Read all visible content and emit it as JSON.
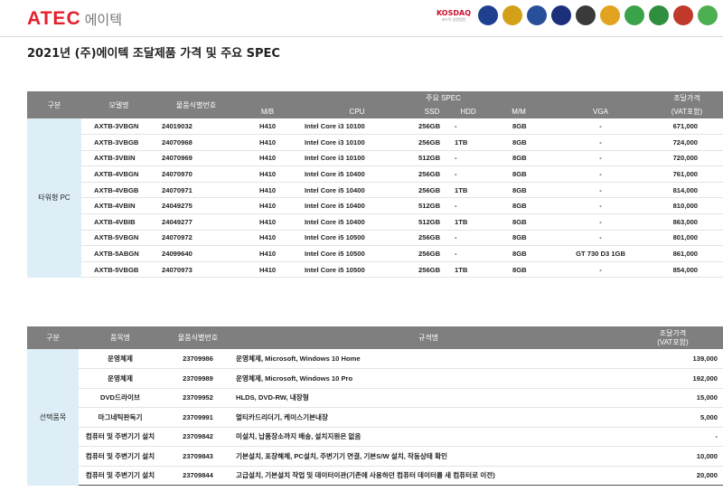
{
  "header": {
    "logo_en": "ATEC",
    "logo_ko": "에이텍",
    "cert_logos": [
      {
        "name": "kosdaq",
        "label": "KOSDAQ",
        "sub": "코스닥 상장법인",
        "color": "#c8102e"
      },
      {
        "name": "cert-circle-1",
        "label": "",
        "color": "#1f3f8f"
      },
      {
        "name": "cert-circle-2",
        "label": "",
        "color": "#d4a017"
      },
      {
        "name": "cert-circle-3",
        "label": "",
        "color": "#2a4f9a"
      },
      {
        "name": "cert-circle-4",
        "label": "",
        "color": "#1c2f7a"
      },
      {
        "name": "cert-circle-5",
        "label": "",
        "color": "#3a3a3a"
      },
      {
        "name": "cert-circle-6",
        "label": "",
        "color": "#e2a320"
      },
      {
        "name": "cert-circle-7",
        "label": "",
        "color": "#3aa34a"
      },
      {
        "name": "cert-circle-8",
        "label": "",
        "color": "#2f8f3f"
      },
      {
        "name": "cert-circle-9",
        "label": "",
        "color": "#c0392b"
      },
      {
        "name": "cert-circle-10",
        "label": "",
        "color": "#4caf50"
      }
    ]
  },
  "title": "2021년 (주)에이텍 조달제품 가격 및 주요 SPEC",
  "table1": {
    "headers": {
      "category": "구분",
      "model": "모델명",
      "item_no": "물품식별번호",
      "spec": "주요 SPEC",
      "price": "조달가격",
      "mb": "M/B",
      "cpu": "CPU",
      "ssd": "SSD",
      "hdd": "HDD",
      "mm": "M/M",
      "vga": "VGA",
      "vat": "(VAT포함)"
    },
    "category": "타워형 PC",
    "rows": [
      {
        "model": "AXTB-3VBGN",
        "item_no": "24019032",
        "mb": "H410",
        "cpu": "Intel Core i3 10100",
        "ssd": "256GB",
        "hdd": "-",
        "mm": "8GB",
        "vga": "-",
        "price": "671,000"
      },
      {
        "model": "AXTB-3VBGB",
        "item_no": "24070968",
        "mb": "H410",
        "cpu": "Intel Core i3 10100",
        "ssd": "256GB",
        "hdd": "1TB",
        "mm": "8GB",
        "vga": "-",
        "price": "724,000"
      },
      {
        "model": "AXTB-3VBIN",
        "item_no": "24070969",
        "mb": "H410",
        "cpu": "Intel Core i3 10100",
        "ssd": "512GB",
        "hdd": "-",
        "mm": "8GB",
        "vga": "-",
        "price": "720,000"
      },
      {
        "model": "AXTB-4VBGN",
        "item_no": "24070970",
        "mb": "H410",
        "cpu": "Intel Core i5 10400",
        "ssd": "256GB",
        "hdd": "-",
        "mm": "8GB",
        "vga": "-",
        "price": "761,000"
      },
      {
        "model": "AXTB-4VBGB",
        "item_no": "24070971",
        "mb": "H410",
        "cpu": "Intel Core i5 10400",
        "ssd": "256GB",
        "hdd": "1TB",
        "mm": "8GB",
        "vga": "-",
        "price": "814,000"
      },
      {
        "model": "AXTB-4VBIN",
        "item_no": "24049275",
        "mb": "H410",
        "cpu": "Intel Core i5 10400",
        "ssd": "512GB",
        "hdd": "-",
        "mm": "8GB",
        "vga": "-",
        "price": "810,000"
      },
      {
        "model": "AXTB-4VBIB",
        "item_no": "24049277",
        "mb": "H410",
        "cpu": "Intel Core i5 10400",
        "ssd": "512GB",
        "hdd": "1TB",
        "mm": "8GB",
        "vga": "-",
        "price": "863,000"
      },
      {
        "model": "AXTB-5VBGN",
        "item_no": "24070972",
        "mb": "H410",
        "cpu": "Intel Core i5 10500",
        "ssd": "256GB",
        "hdd": "-",
        "mm": "8GB",
        "vga": "-",
        "price": "801,000"
      },
      {
        "model": "AXTB-5ABGN",
        "item_no": "24099640",
        "mb": "H410",
        "cpu": "Intel Core i5 10500",
        "ssd": "256GB",
        "hdd": "-",
        "mm": "8GB",
        "vga": "GT 730 D3 1GB",
        "price": "861,000"
      },
      {
        "model": "AXTB-5VBGB",
        "item_no": "24070973",
        "mb": "H410",
        "cpu": "Intel Core i5 10500",
        "ssd": "256GB",
        "hdd": "1TB",
        "mm": "8GB",
        "vga": "-",
        "price": "854,000"
      }
    ]
  },
  "table2": {
    "headers": {
      "category": "구분",
      "name": "품목명",
      "item_no": "물품식별번호",
      "spec": "규격명",
      "price_line1": "조달가격",
      "price_line2": "(VAT포함)"
    },
    "category": "선택품목",
    "rows": [
      {
        "name": "운영체제",
        "item_no": "23709986",
        "spec": "운영체제, Microsoft, Windows 10 Home",
        "price": "139,000"
      },
      {
        "name": "운영체제",
        "item_no": "23709989",
        "spec": "운영체제, Microsoft, Windows 10 Pro",
        "price": "192,000"
      },
      {
        "name": "DVD드라이브",
        "item_no": "23709952",
        "spec": "HLDS, DVD-RW, 내장형",
        "price": "15,000"
      },
      {
        "name": "마그네틱판독기",
        "item_no": "23709991",
        "spec": "멀티카드리더기, 케이스기본내장",
        "price": "5,000"
      },
      {
        "name": "컴퓨터 및 주변기기 설치",
        "item_no": "23709842",
        "spec": "미설치, 납품장소까지 배송, 설치지원은 없음",
        "price": "-"
      },
      {
        "name": "컴퓨터 및 주변기기 설치",
        "item_no": "23709843",
        "spec": "기본설치, 포장해체, PC설치, 주변기기 연결, 기본S/W 설치, 작동상태 확인",
        "price": "10,000"
      },
      {
        "name": "컴퓨터 및 주변기기 설치",
        "item_no": "23709844",
        "spec": "고급설치, 기본설치 작업 및 데이터이관(기존에 사용하던 컴퓨터 데이터를 새 컴퓨터로 이전)",
        "price": "20,000"
      }
    ]
  }
}
